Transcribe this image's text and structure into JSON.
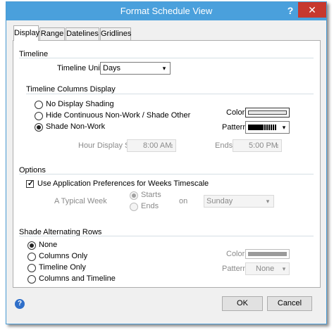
{
  "window": {
    "title": "Format Schedule View",
    "help_glyph": "?",
    "close_glyph": "✕"
  },
  "tabs": [
    {
      "label": "Display",
      "active": true
    },
    {
      "label": "Range",
      "active": false
    },
    {
      "label": "Datelines",
      "active": false
    },
    {
      "label": "Gridlines",
      "active": false
    }
  ],
  "timeline": {
    "section_label": "Timeline",
    "units_label": "Timeline Units:",
    "units_value": "Days",
    "columns_display_label": "Timeline Columns Display",
    "options": [
      {
        "label": "No Display Shading",
        "selected": false
      },
      {
        "label": "Hide Continuous Non-Work / Shade Other",
        "selected": false
      },
      {
        "label": "Shade Non-Work",
        "selected": true
      }
    ],
    "color_label": "Color:",
    "pattern_label": "Pattern:",
    "hour_display_starts_label": "Hour Display Starts:",
    "hour_display_starts_value": "8:00 AM",
    "ends_label": "Ends:",
    "ends_value": "5:00 PM"
  },
  "options": {
    "section_label": "Options",
    "use_app_prefs_label": "Use Application Preferences for Weeks Timescale",
    "use_app_prefs_checked": true,
    "typical_week_label": "A Typical Week",
    "starts_label": "Starts",
    "ends_label": "Ends",
    "on_label": "on",
    "day_value": "Sunday"
  },
  "shade_rows": {
    "section_label": "Shade Alternating Rows",
    "options": [
      {
        "label": "None",
        "selected": true
      },
      {
        "label": "Columns Only",
        "selected": false
      },
      {
        "label": "Timeline Only",
        "selected": false
      },
      {
        "label": "Columns and Timeline",
        "selected": false
      }
    ],
    "color_label": "Color:",
    "pattern_label": "Pattern:",
    "pattern_value": "None"
  },
  "footer": {
    "ok_label": "OK",
    "cancel_label": "Cancel",
    "help_glyph": "?"
  },
  "icons": {
    "dropdown_arrow": "▾",
    "spinner_arrow": "↕",
    "check": "✓"
  }
}
